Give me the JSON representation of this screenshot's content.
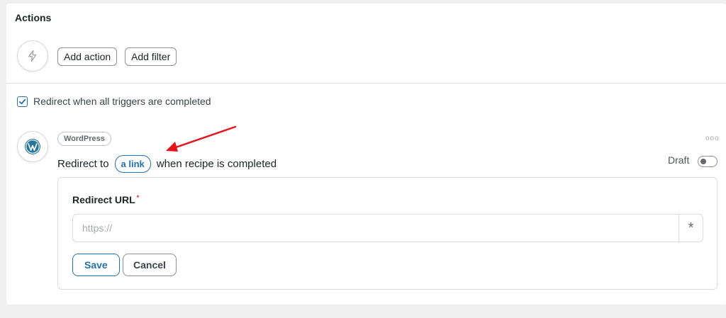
{
  "actions": {
    "title": "Actions",
    "icon": "bolt-icon",
    "add_action_label": "Add action",
    "add_filter_label": "Add filter"
  },
  "redirect_option": {
    "checked": true,
    "label": "Redirect when all triggers are completed"
  },
  "action_item": {
    "integration_icon": "wordpress-icon",
    "integration_tag": "WordPress",
    "sentence_prefix": "Redirect to",
    "sentence_token": "a link",
    "sentence_suffix": "when recipe is completed",
    "more_icon": "ooo",
    "status_label": "Draft",
    "status_on": false
  },
  "form": {
    "field_label": "Redirect URL",
    "required_mark": "*",
    "url_value": "",
    "url_placeholder": "https://",
    "token_icon": "*",
    "save_label": "Save",
    "cancel_label": "Cancel"
  },
  "colors": {
    "accent": "#2271b1",
    "annotation_arrow": "#e3141a",
    "required": "#d63638"
  }
}
